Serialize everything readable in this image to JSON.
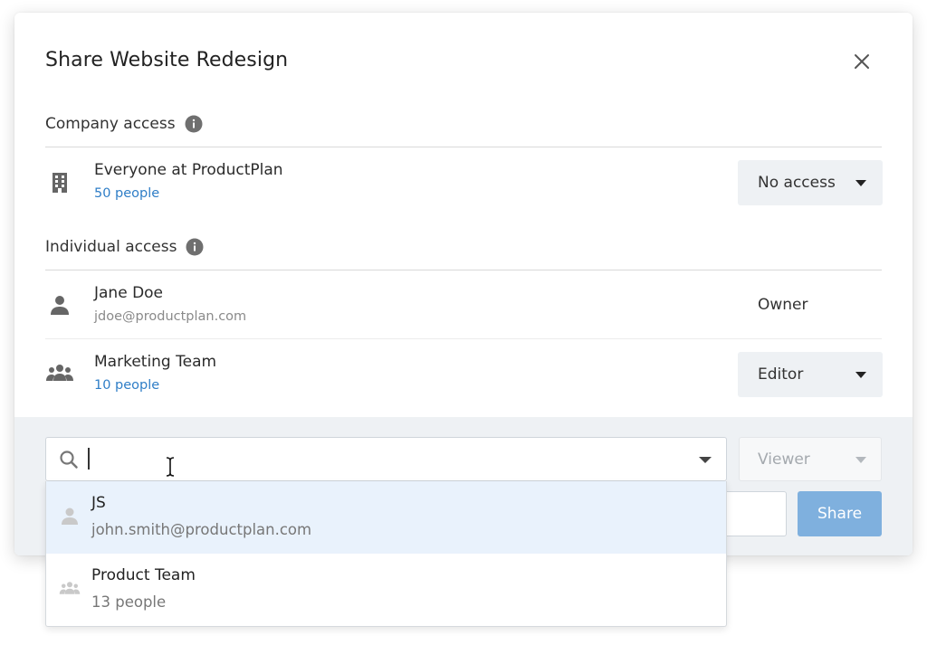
{
  "dialog": {
    "title": "Share Website Redesign"
  },
  "company_access": {
    "label": "Company access",
    "entity": {
      "icon": "building-icon",
      "name": "Everyone at ProductPlan",
      "count": "50 people",
      "permission": "No access"
    }
  },
  "individual_access": {
    "label": "Individual access",
    "entries": [
      {
        "icon": "person-icon",
        "name": "Jane Doe",
        "detail": "jdoe@productplan.com",
        "permission": "Owner"
      },
      {
        "icon": "group-icon",
        "name": "Marketing Team",
        "detail": "10 people",
        "permission": "Editor"
      }
    ]
  },
  "share_form": {
    "search_value": "",
    "role": "Viewer",
    "share_label": "Share",
    "suggestions": [
      {
        "icon": "person-icon",
        "name": "JS",
        "detail": "john.smith@productplan.com",
        "highlighted": true
      },
      {
        "icon": "group-icon",
        "name": "Product Team",
        "detail": "13 people",
        "highlighted": false
      }
    ]
  },
  "colors": {
    "link": "#2f7ec7",
    "share_button": "#7fb0de",
    "footer_bg": "#eef1f4",
    "highlight_bg": "#e9f2fc"
  }
}
